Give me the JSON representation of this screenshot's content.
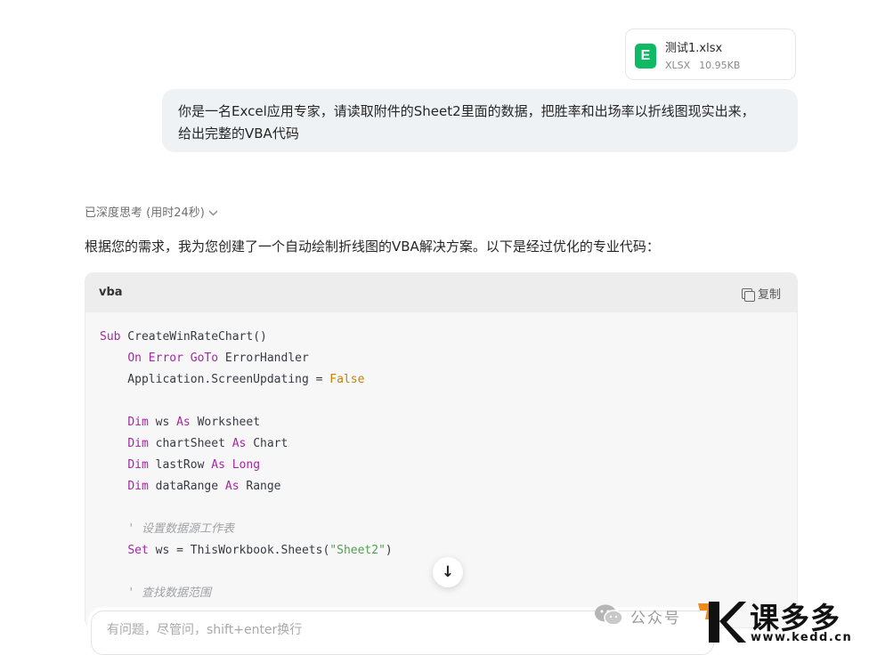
{
  "attachment": {
    "file_name": "测试1.xlsx",
    "file_type": "XLSX",
    "file_size": "10.95KB",
    "icon_letter": "E",
    "icon_color": "#10b964"
  },
  "user_message": {
    "line1": "你是一名Excel应用专家，请读取附件的Sheet2里面的数据，把胜率和出场率以折线图现实出来，",
    "line2": "给出完整的VBA代码"
  },
  "thinking": {
    "label": "已深度思考 (用时24秒)",
    "icon": "chevron-down-icon"
  },
  "assistant": {
    "intro": "根据您的需求，我为您创建了一个自动绘制折线图的VBA解决方案。以下是经过优化的专业代码："
  },
  "code_block": {
    "language": "vba",
    "copy_label": "复制",
    "lines": [
      [
        {
          "t": "Sub",
          "c": "kw"
        },
        {
          "t": " CreateWinRateChart()"
        }
      ],
      [
        {
          "t": "    "
        },
        {
          "t": "On Error GoTo",
          "c": "kw"
        },
        {
          "t": " ErrorHandler"
        }
      ],
      [
        {
          "t": "    Application.ScreenUpdating = "
        },
        {
          "t": "False",
          "c": "bool"
        }
      ],
      [
        {
          "t": ""
        }
      ],
      [
        {
          "t": "    "
        },
        {
          "t": "Dim",
          "c": "kw"
        },
        {
          "t": " ws "
        },
        {
          "t": "As",
          "c": "kw"
        },
        {
          "t": " Worksheet"
        }
      ],
      [
        {
          "t": "    "
        },
        {
          "t": "Dim",
          "c": "kw"
        },
        {
          "t": " chartSheet "
        },
        {
          "t": "As",
          "c": "kw"
        },
        {
          "t": " Chart"
        }
      ],
      [
        {
          "t": "    "
        },
        {
          "t": "Dim",
          "c": "kw"
        },
        {
          "t": " lastRow "
        },
        {
          "t": "As",
          "c": "kw"
        },
        {
          "t": " "
        },
        {
          "t": "Long",
          "c": "kw"
        }
      ],
      [
        {
          "t": "    "
        },
        {
          "t": "Dim",
          "c": "kw"
        },
        {
          "t": " dataRange "
        },
        {
          "t": "As",
          "c": "kw"
        },
        {
          "t": " Range"
        }
      ],
      [
        {
          "t": ""
        }
      ],
      [
        {
          "t": "    "
        },
        {
          "t": "' 设置数据源工作表",
          "c": "cmt"
        }
      ],
      [
        {
          "t": "    "
        },
        {
          "t": "Set",
          "c": "kw"
        },
        {
          "t": " ws = ThisWorkbook.Sheets("
        },
        {
          "t": "\"Sheet2\"",
          "c": "str"
        },
        {
          "t": ")"
        }
      ],
      [
        {
          "t": ""
        }
      ],
      [
        {
          "t": "    "
        },
        {
          "t": "' 查找数据范围",
          "c": "cmt"
        }
      ]
    ]
  },
  "scroll_button": {
    "icon": "arrow-down-icon",
    "glyph": "↓"
  },
  "chat_input": {
    "placeholder": "有问题，尽管问，shift+enter换行",
    "value": ""
  },
  "watermark": {
    "text": "公众号",
    "brand": "课多多",
    "url": "www.kedd.cn",
    "brand_color": "#f08a1c"
  }
}
